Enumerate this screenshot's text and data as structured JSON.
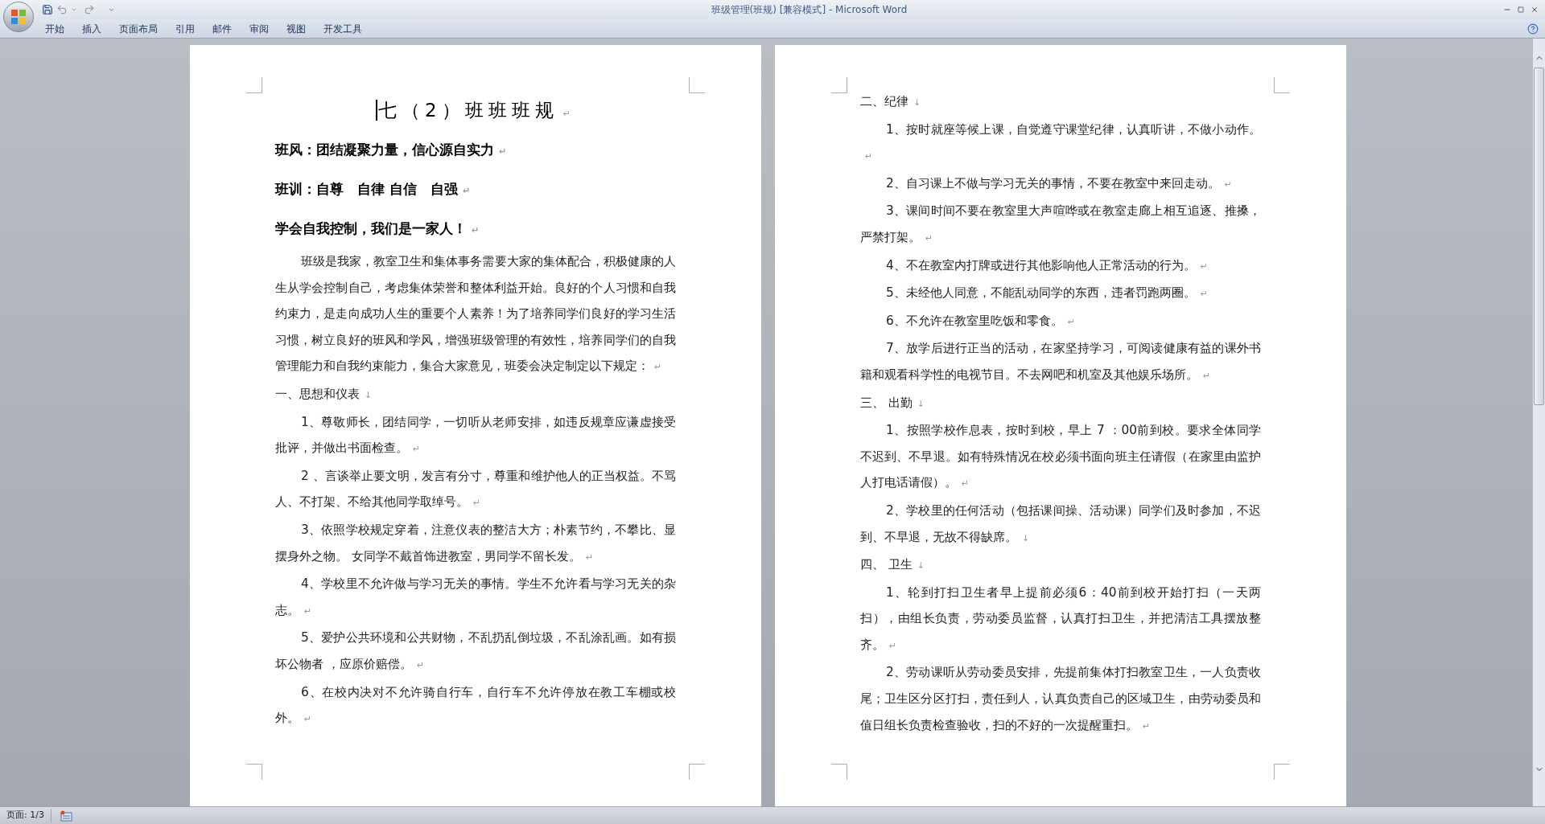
{
  "window": {
    "title": "班级管理(班规) [兼容模式] - Microsoft Word"
  },
  "ribbon_tabs": [
    {
      "label": "开始"
    },
    {
      "label": "插入"
    },
    {
      "label": "页面布局"
    },
    {
      "label": "引用"
    },
    {
      "label": "邮件"
    },
    {
      "label": "审阅"
    },
    {
      "label": "视图"
    },
    {
      "label": "开发工具"
    }
  ],
  "pages": [
    {
      "blocks": [
        {
          "kind": "title",
          "text": "七（2）班班班规",
          "end_mark": "↵"
        },
        {
          "kind": "motto",
          "text": "班风：团结凝聚力量，信心源自实力",
          "end_mark": "↵"
        },
        {
          "kind": "motto",
          "text": "班训：自尊　自律 自信　自强",
          "end_mark": "↵"
        },
        {
          "kind": "motto",
          "text": "学会自我控制，我们是一家人！",
          "end_mark": "↵"
        },
        {
          "kind": "item",
          "text": "班级是我家，教室卫生和集体事务需要大家的集体配合，积极健康的人生从学会控制自己，考虑集体荣誉和整体利益开始。良好的个人习惯和自我约束力，是走向成功人生的重要个人素养！为了培养同学们良好的学习生活习惯，树立良好的班风和学风，增强班级管理的有效性，培养同学们的自我管理能力和自我约束能力，集合大家意见，班委会决定制定以下规定：",
          "end_mark": "↵"
        },
        {
          "kind": "heading",
          "text": "一、思想和仪表",
          "end_mark": "↓"
        },
        {
          "kind": "item",
          "text": "1、尊敬师长，团结同学，一切听从老师安排，如违反规章应谦虚接受批评，并做出书面检查。",
          "end_mark": "↵"
        },
        {
          "kind": "item",
          "text": "2 、言谈举止要文明，发言有分寸，尊重和维护他人的正当权益。不骂人、不打架、不给其他同学取绰号。",
          "end_mark": "↵"
        },
        {
          "kind": "item",
          "text": "3、依照学校规定穿着，注意仪表的整洁大方；朴素节约，不攀比、显摆身外之物。 女同学不戴首饰进教室，男同学不留长发。",
          "end_mark": "↵"
        },
        {
          "kind": "item",
          "text": "4、学校里不允许做与学习无关的事情。学生不允许看与学习无关的杂志。",
          "end_mark": "↵"
        },
        {
          "kind": "item",
          "text": "5、爱护公共环境和公共财物，不乱扔乱倒垃圾，不乱涂乱画。如有损坏公物者 ，应原价赔偿。",
          "end_mark": "↵"
        },
        {
          "kind": "item",
          "text": "6、在校内决对不允许骑自行车，自行车不允许停放在教工车棚或校外。",
          "end_mark": "↵"
        }
      ]
    },
    {
      "blocks": [
        {
          "kind": "heading",
          "text": "二、纪律",
          "end_mark": "↓"
        },
        {
          "kind": "item",
          "text": "1、按时就座等候上课，自觉遵守课堂纪律，认真听讲，不做小动作。",
          "end_mark": "↵"
        },
        {
          "kind": "item",
          "text": "2、自习课上不做与学习无关的事情，不要在教室中来回走动。",
          "end_mark": "↵"
        },
        {
          "kind": "item",
          "text": "3、课间时间不要在教室里大声喧哗或在教室走廊上相互追逐、推搡，严禁打架。",
          "end_mark": "↵"
        },
        {
          "kind": "item",
          "text": "4、不在教室内打牌或进行其他影响他人正常活动的行为。",
          "end_mark": "↵"
        },
        {
          "kind": "item",
          "text": "5、未经他人同意，不能乱动同学的东西，违者罚跑两圈。",
          "end_mark": "↵"
        },
        {
          "kind": "item",
          "text": "6、不允许在教室里吃饭和零食。",
          "end_mark": "↵"
        },
        {
          "kind": "item",
          "text": "7、放学后进行正当的活动，在家坚持学习，可阅读健康有益的课外书籍和观看科学性的电视节目。不去网吧和机室及其他娱乐场所。",
          "end_mark": "↵"
        },
        {
          "kind": "heading",
          "text": "三、 出勤",
          "end_mark": "↓"
        },
        {
          "kind": "item",
          "text": "1、按照学校作息表，按时到校，早上 7 ：00前到校。要求全体同学不迟到、不早退。如有特殊情况在校必须书面向班主任请假（在家里由监护人打电话请假）。",
          "end_mark": "↵"
        },
        {
          "kind": "item",
          "text": "2、学校里的任何活动（包括课间操、活动课）同学们及时参加，不迟到、不早退，无故不得缺席。",
          "end_mark": "↓"
        },
        {
          "kind": "heading",
          "text": "四、 卫生",
          "end_mark": "↓"
        },
        {
          "kind": "item",
          "text": "1、轮到打扫卫生者早上提前必须6：40前到校开始打扫（一天两扫），由组长负责，劳动委员监督，认真打扫卫生，并把清洁工具摆放整齐。",
          "end_mark": "↵"
        },
        {
          "kind": "item",
          "text": "2、劳动课听从劳动委员安排，先提前集体打扫教室卫生，一人负责收尾；卫生区分区打扫，责任到人，认真负责自己的区域卫生，由劳动委员和值日组长负责检查验收，扫的不好的一次提醒重扫。",
          "end_mark": "↵"
        }
      ]
    }
  ],
  "status_bar": {
    "page": "页面: 1/3"
  }
}
